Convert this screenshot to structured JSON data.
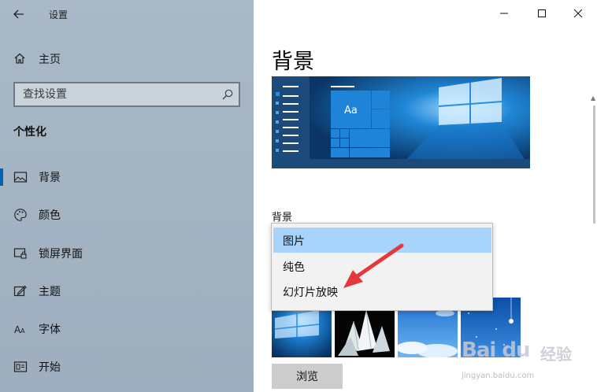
{
  "window": {
    "title": "设置",
    "minimize_icon": "minimize-icon",
    "maximize_icon": "maximize-icon",
    "close_icon": "close-icon"
  },
  "sidebar": {
    "home_label": "主页",
    "search_placeholder": "查找设置",
    "section_title": "个性化",
    "items": [
      {
        "label": "背景",
        "icon": "picture-icon",
        "active": true
      },
      {
        "label": "颜色",
        "icon": "palette-icon",
        "active": false
      },
      {
        "label": "锁屏界面",
        "icon": "lock-screen-icon",
        "active": false
      },
      {
        "label": "主题",
        "icon": "theme-icon",
        "active": false
      },
      {
        "label": "字体",
        "icon": "font-icon",
        "active": false
      },
      {
        "label": "开始",
        "icon": "start-icon",
        "active": false
      }
    ]
  },
  "main": {
    "page_title": "背景",
    "preview_tile_text": "Aa",
    "background_label": "背景",
    "dropdown_options": [
      {
        "label": "图片",
        "selected": true
      },
      {
        "label": "纯色",
        "selected": false
      },
      {
        "label": "幻灯片放映",
        "selected": false
      }
    ],
    "browse_label": "浏览"
  },
  "watermark": {
    "brand": "Bai du",
    "brand_cn": "经验",
    "url": "jingyan.baidu.com"
  },
  "colors": {
    "accent": "#0063b1",
    "selected_option": "#a8d4fc",
    "arrow": "#e3393c"
  }
}
